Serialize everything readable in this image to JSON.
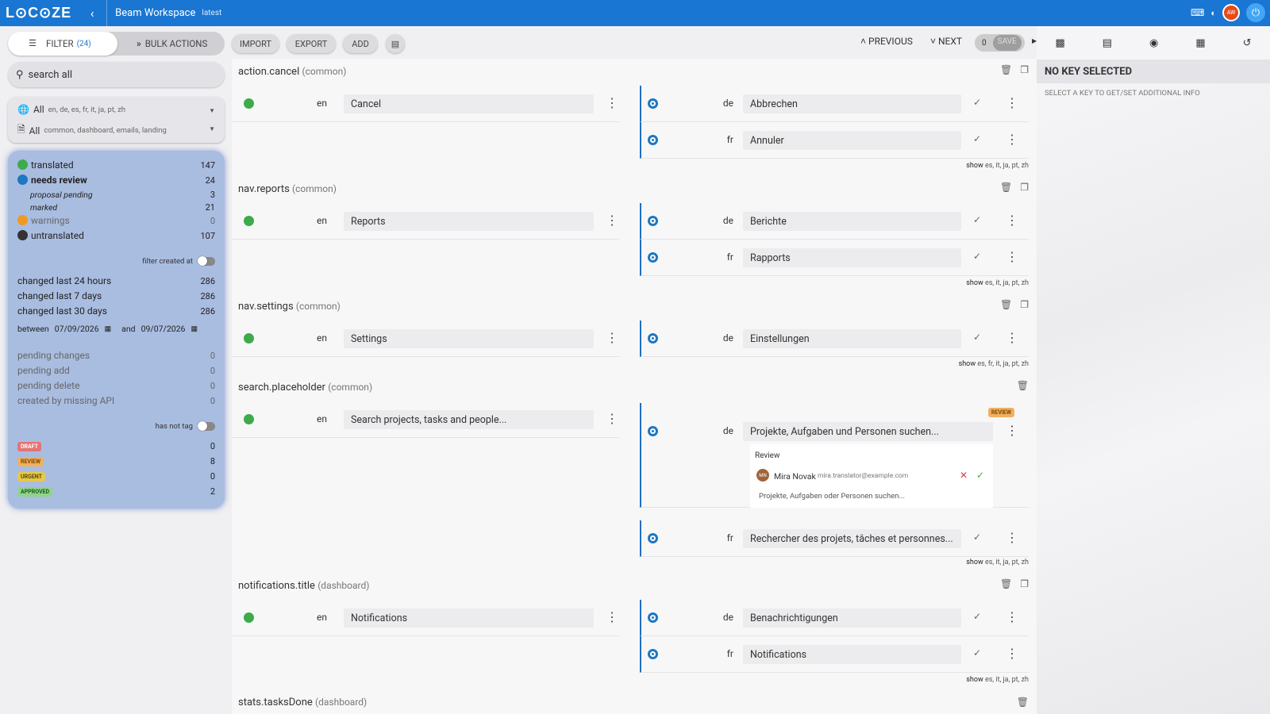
{
  "topbar": {
    "logo": "L⊙C⊙ZE",
    "workspace": "Beam Workspace",
    "version": "latest",
    "avatar": "AW"
  },
  "sidebar": {
    "filter_label": "FILTER",
    "filter_count": "(24)",
    "bulk_label": "BULK ACTIONS",
    "search_placeholder": "search all",
    "lang_sel": {
      "value": "All",
      "detail": "en, de, es, fr, it, ja, pt, zh"
    },
    "ns_sel": {
      "value": "All",
      "detail": "common, dashboard, emails, landing"
    },
    "status": [
      {
        "label": "translated",
        "count": "147"
      },
      {
        "label": "needs review",
        "count": "24"
      },
      {
        "label": "proposal pending",
        "count": "3"
      },
      {
        "label": "marked",
        "count": "21"
      },
      {
        "label": "warnings",
        "count": "0"
      },
      {
        "label": "untranslated",
        "count": "107"
      }
    ],
    "filter_created_label": "filter created at",
    "changed": [
      {
        "label": "changed last 24 hours",
        "count": "286"
      },
      {
        "label": "changed last 7 days",
        "count": "286"
      },
      {
        "label": "changed last 30 days",
        "count": "286"
      }
    ],
    "between_label": "between",
    "date_from": "07/09/2026",
    "and_label": "and",
    "date_to": "09/07/2026",
    "pending": [
      {
        "label": "pending changes",
        "count": "0"
      },
      {
        "label": "pending add",
        "count": "0"
      },
      {
        "label": "pending delete",
        "count": "0"
      },
      {
        "label": "created by missing API",
        "count": "0"
      }
    ],
    "has_not_tag_label": "has not tag",
    "tags": [
      {
        "label": "DRAFT",
        "count": "0",
        "bg": "#e57373",
        "fg": "#fff"
      },
      {
        "label": "REVIEW",
        "count": "8",
        "bg": "#f0b060",
        "fg": "#7a4a00"
      },
      {
        "label": "URGENT",
        "count": "0",
        "bg": "#e6c84a",
        "fg": "#5a4a00"
      },
      {
        "label": "APPROVED",
        "count": "2",
        "bg": "#8fd48a",
        "fg": "#1f5a1a"
      }
    ]
  },
  "toolbar": {
    "import": "IMPORT",
    "export": "EXPORT",
    "add": "ADD",
    "previous": "PREVIOUS",
    "next": "NEXT",
    "save_count": "0",
    "save": "SAVE"
  },
  "keys": [
    {
      "key": "action.cancel",
      "ns": "(common)",
      "en": "Cancel",
      "de": "Abbrechen",
      "fr": "Annuler",
      "show_label": "show",
      "show_langs": "es, it, ja, pt, zh"
    },
    {
      "key": "nav.reports",
      "ns": "(common)",
      "en": "Reports",
      "de": "Berichte",
      "fr": "Rapports",
      "show_label": "show",
      "show_langs": "es, it, ja, pt, zh"
    },
    {
      "key": "nav.settings",
      "ns": "(common)",
      "en": "Settings",
      "de": "Einstellungen",
      "show_label": "show",
      "show_langs": "es, fr, it, ja, pt, zh"
    },
    {
      "key": "search.placeholder",
      "ns": "(common)",
      "en": "Search projects, tasks and people...",
      "de": "Projekte, Aufgaben und Personen suchen...",
      "fr": "Rechercher des projets, tâches et personnes...",
      "show_label": "show",
      "show_langs": "es, it, ja, pt, zh",
      "tag": "REVIEW",
      "review": {
        "title": "Review",
        "user_initials": "MN",
        "user": "Mira Novak",
        "email": "mira.translator@example.com",
        "proposal": "Projekte, Aufgaben oder Personen suchen..."
      }
    },
    {
      "key": "notifications.title",
      "ns": "(dashboard)",
      "en": "Notifications",
      "de": "Benachrichtigungen",
      "fr": "Notifications",
      "show_label": "show",
      "show_langs": "es, it, ja, pt, zh"
    },
    {
      "key": "stats.tasksDone",
      "ns": "(dashboard)"
    }
  ],
  "lang_codes": {
    "en": "en",
    "de": "de",
    "fr": "fr"
  },
  "right_panel": {
    "title": "NO KEY SELECTED",
    "subtitle": "SELECT A KEY TO GET/SET ADDITIONAL INFO"
  },
  "colors": {
    "brand": "#1976d2",
    "translated": "#3cab4a",
    "review": "#1d77c1",
    "warning": "#f29a1f"
  }
}
